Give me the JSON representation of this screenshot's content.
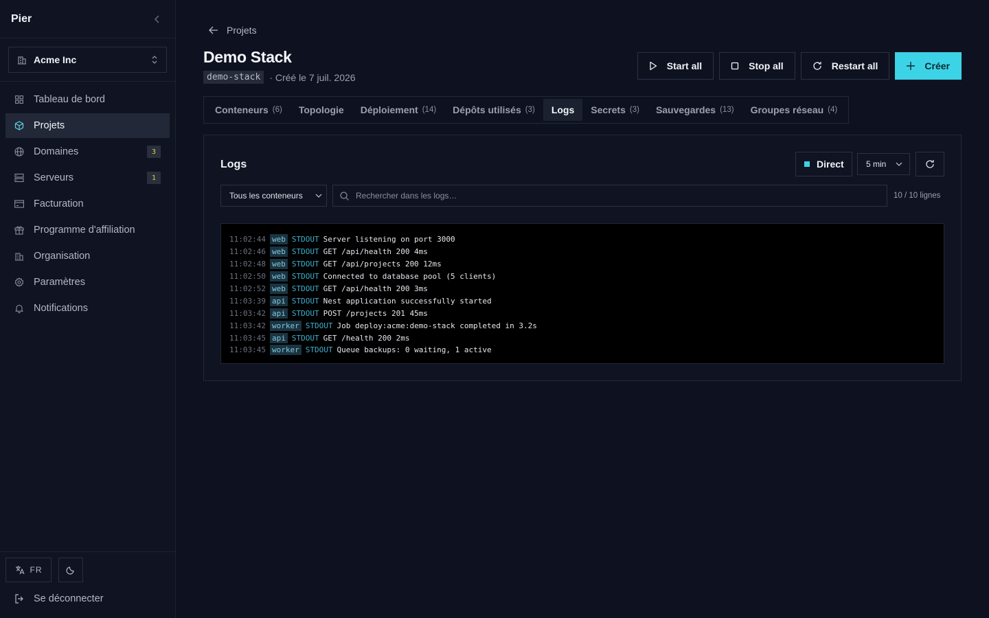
{
  "sidebar": {
    "brand": "Pier",
    "org_name": "Acme Inc",
    "nav": [
      {
        "label": "Tableau de bord",
        "icon": "grid-icon",
        "badge": ""
      },
      {
        "label": "Projets",
        "icon": "box-icon",
        "badge": ""
      },
      {
        "label": "Domaines",
        "icon": "globe-icon",
        "badge": "3"
      },
      {
        "label": "Serveurs",
        "icon": "server-icon",
        "badge": "1"
      },
      {
        "label": "Facturation",
        "icon": "card-icon",
        "badge": ""
      },
      {
        "label": "Programme d'affiliation",
        "icon": "gift-icon",
        "badge": ""
      },
      {
        "label": "Organisation",
        "icon": "building-icon",
        "badge": ""
      },
      {
        "label": "Paramètres",
        "icon": "gear-icon",
        "badge": ""
      },
      {
        "label": "Notifications",
        "icon": "bell-icon",
        "badge": ""
      }
    ],
    "active_index": 1,
    "lang": "FR",
    "logout": "Se déconnecter"
  },
  "header": {
    "back_label": "Projets",
    "title": "Demo Stack",
    "slug": "demo-stack",
    "created": "· Créé le 7 juil. 2026",
    "actions": {
      "start_all": "Start all",
      "stop_all": "Stop all",
      "restart_all": "Restart all",
      "create": "Créer"
    }
  },
  "tabs": [
    {
      "label": "Conteneurs",
      "count": "(6)"
    },
    {
      "label": "Topologie",
      "count": ""
    },
    {
      "label": "Déploiement",
      "count": "(14)"
    },
    {
      "label": "Dépôts utilisés",
      "count": "(3)"
    },
    {
      "label": "Logs",
      "count": ""
    },
    {
      "label": "Secrets",
      "count": "(3)"
    },
    {
      "label": "Sauvegardes",
      "count": "(13)"
    },
    {
      "label": "Groupes réseau",
      "count": "(4)"
    }
  ],
  "active_tab": 4,
  "logs_panel": {
    "title": "Logs",
    "live_label": "Direct",
    "range": "5 min",
    "container_filter": "Tous les conteneurs",
    "search_placeholder": "Rechercher dans les logs…",
    "line_count": "10 / 10 lignes",
    "lines": [
      {
        "time": "11:02:44",
        "source": "web",
        "stream": "STDOUT",
        "message": "Server listening on port 3000"
      },
      {
        "time": "11:02:46",
        "source": "web",
        "stream": "STDOUT",
        "message": "GET /api/health 200 4ms"
      },
      {
        "time": "11:02:48",
        "source": "web",
        "stream": "STDOUT",
        "message": "GET /api/projects 200 12ms"
      },
      {
        "time": "11:02:50",
        "source": "web",
        "stream": "STDOUT",
        "message": "Connected to database pool (5 clients)"
      },
      {
        "time": "11:02:52",
        "source": "web",
        "stream": "STDOUT",
        "message": "GET /api/health 200 3ms"
      },
      {
        "time": "11:03:39",
        "source": "api",
        "stream": "STDOUT",
        "message": "Nest application successfully started"
      },
      {
        "time": "11:03:42",
        "source": "api",
        "stream": "STDOUT",
        "message": "POST /projects 201 45ms"
      },
      {
        "time": "11:03:42",
        "source": "worker",
        "stream": "STDOUT",
        "message": "Job deploy:acme:demo-stack completed in 3.2s"
      },
      {
        "time": "11:03:45",
        "source": "api",
        "stream": "STDOUT",
        "message": "GET /health 200 2ms"
      },
      {
        "time": "11:03:45",
        "source": "worker",
        "stream": "STDOUT",
        "message": "Queue backups: 0 waiting, 1 active"
      }
    ]
  },
  "colors": {
    "accent": "#3dd3e6",
    "background": "#0e1220",
    "badge_text": "#e6c84c"
  }
}
